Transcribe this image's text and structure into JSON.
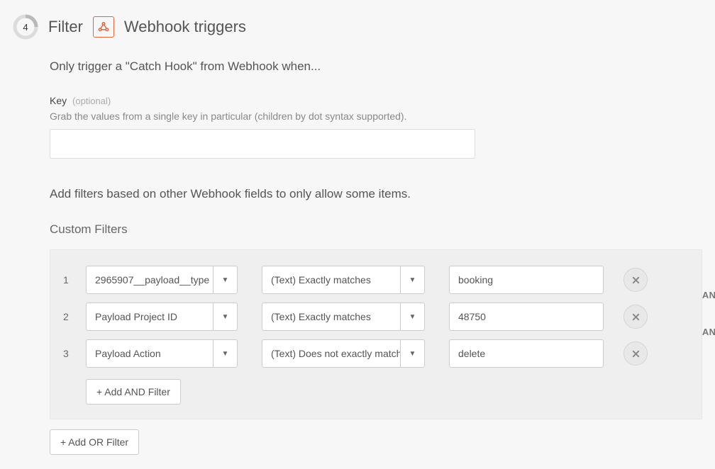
{
  "header": {
    "step_number": "4",
    "title": "Filter",
    "app_name": "Webhook triggers"
  },
  "lead_text": "Only trigger a \"Catch Hook\" from Webhook when...",
  "key_field": {
    "label": "Key",
    "optional": "(optional)",
    "help": "Grab the values from a single key in particular (children by dot syntax supported).",
    "value": ""
  },
  "filters_intro": "Add filters based on other Webhook fields to only allow some items.",
  "filters_heading": "Custom Filters",
  "filters": [
    {
      "num": "1",
      "field": "2965907__payload__type",
      "op": "(Text) Exactly matches",
      "value": "booking",
      "joiner": "AND"
    },
    {
      "num": "2",
      "field": "Payload Project ID",
      "op": "(Text) Exactly matches",
      "value": "48750",
      "joiner": "AND"
    },
    {
      "num": "3",
      "field": "Payload Action",
      "op": "(Text) Does not exactly match",
      "value": "delete",
      "joiner": ""
    }
  ],
  "buttons": {
    "add_and": "+ Add AND Filter",
    "add_or": "+ Add OR Filter"
  }
}
